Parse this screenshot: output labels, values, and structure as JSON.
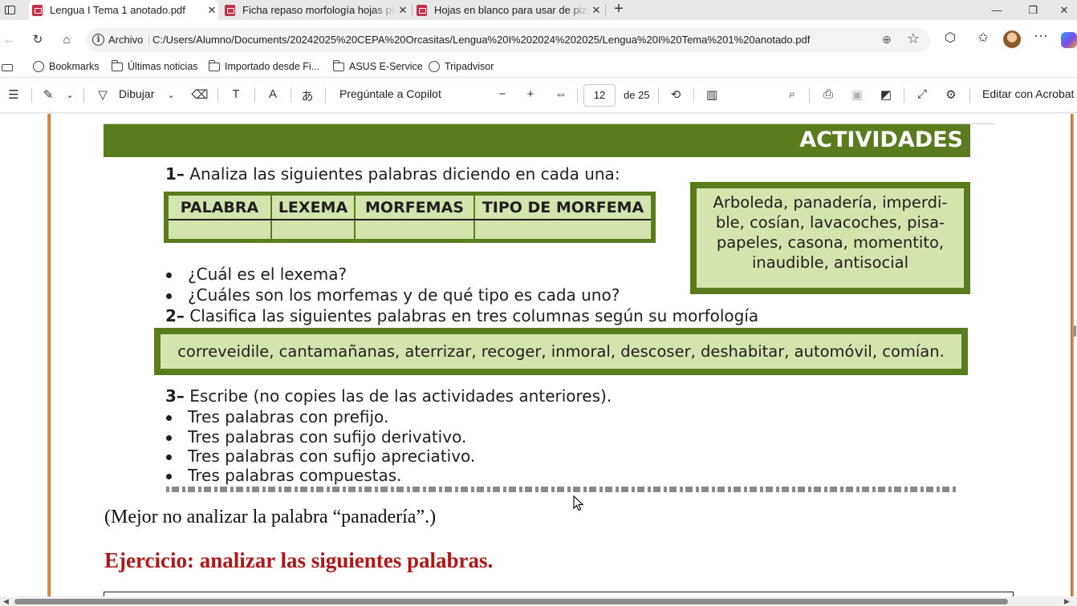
{
  "tabs": [
    {
      "title": "Lengua I Tema 1 anotado.pdf",
      "active": true
    },
    {
      "title": "Ficha repaso morfología hojas pizarra",
      "active": false
    },
    {
      "title": "Hojas en blanco para usar de pizarra",
      "active": false
    }
  ],
  "window": {
    "new_tab": "+",
    "minimize": "—",
    "restore": "❐",
    "close": "✕"
  },
  "address": {
    "info_label": "Archivo",
    "url": "C:/Users/Alumno/Documents/20242025%20CEPA%20Orcasitas/Lengua%20I%202024%202025/Lengua%20I%20Tema%201%20anotado.pdf"
  },
  "favorites": [
    {
      "label": "Bookmarks",
      "icon": "globe-icon"
    },
    {
      "label": "Últimas noticias",
      "icon": "folder-icon"
    },
    {
      "label": "Importado desde Fi...",
      "icon": "folder-icon"
    },
    {
      "label": "ASUS E-Service",
      "icon": "folder-icon"
    },
    {
      "label": "Tripadvisor",
      "icon": "globe-icon"
    }
  ],
  "pdf_toolbar": {
    "draw_label": "Dibujar",
    "copilot_label": "Pregúntale a Copilot",
    "page_current": "12",
    "page_total": "de 25",
    "acrobat_label": "Editar con Acrobat"
  },
  "document": {
    "banner": "ACTIVIDADES",
    "q1_num": "1–",
    "q1_text": "Analiza las siguientes palabras diciendo en cada una:",
    "table_headers": [
      "PALABRA",
      "LEXEMA",
      "MORFEMAS",
      "TIPO DE MORFEMA"
    ],
    "box1_words": "Arboleda, panadería, imperdi-ble, cosían, lavacoches, pisa-papeles, casona, momentito, inaudible, antisocial",
    "box1_lines": [
      "Arboleda, panadería, imperdi-",
      "ble, cosían, lavacoches, pisa-",
      "papeles, casona, momentito,",
      "inaudible, antisocial"
    ],
    "q1_bullets": [
      "¿Cuál es el lexema?",
      "¿Cuáles son los morfemas y de qué tipo es cada uno?"
    ],
    "q2_num": "2–",
    "q2_text": "Clasifica las siguientes palabras en tres columnas según su morfología",
    "box2_words": "correveidile, cantamañanas, aterrizar, recoger, inmoral, descoser, deshabitar, automóvil, comían.",
    "q3_num": "3–",
    "q3_text": "Escribe (no copies las de las actividades anteriores).",
    "q3_bullets": [
      "Tres palabras con prefijo.",
      "Tres palabras con sufijo derivativo.",
      "Tres palabras con sufijo apreciativo.",
      "Tres palabras compuestas."
    ],
    "note": "(Mejor no analizar la palabra “panadería”.)",
    "exercise_heading": "Ejercicio: analizar las siguientes palabras."
  },
  "colors": {
    "banner_green": "#5a7b1e",
    "box_fill": "#d3e5ad",
    "heading_red": "#b01818",
    "page_border": "#c06a26"
  }
}
